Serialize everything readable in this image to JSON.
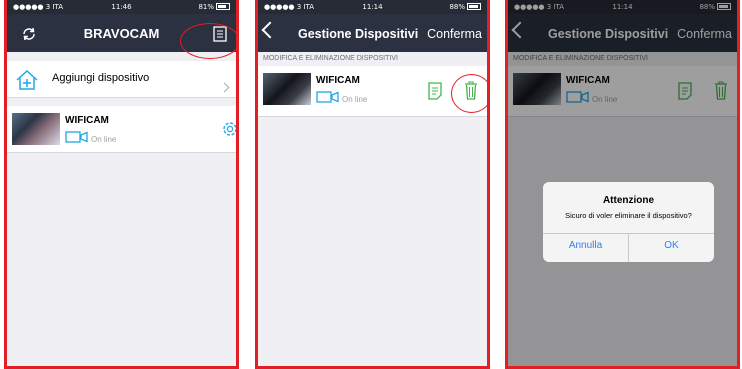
{
  "screens": [
    {
      "status": {
        "carrier": "●●●●● 3 ITA",
        "time": "11:46",
        "battery": "81%"
      },
      "nav": {
        "title": "BRAVOCAM"
      },
      "add_device": {
        "label": "Aggiungi dispositivo"
      },
      "device": {
        "name": "WIFICAM",
        "status": "On line"
      }
    },
    {
      "status": {
        "carrier": "●●●●● 3 ITA",
        "time": "11:14",
        "battery": "88%"
      },
      "nav": {
        "title": "Gestione Dispositivi",
        "confirm": "Conferma"
      },
      "section": "MODIFICA E ELIMINAZIONE DISPOSITIVI",
      "device": {
        "name": "WIFICAM",
        "status": "On line"
      }
    },
    {
      "status": {
        "carrier": "●●●●● 3 ITA",
        "time": "11:14",
        "battery": "88%"
      },
      "nav": {
        "title": "Gestione Dispositivi",
        "confirm": "Conferma"
      },
      "section": "MODIFICA E ELIMINAZIONE DISPOSITIVI",
      "device": {
        "name": "WIFICAM",
        "status": "On line"
      },
      "dialog": {
        "title": "Attenzione",
        "message": "Sicuro di voler eliminare il dispositivo?",
        "cancel": "Annulla",
        "ok": "OK"
      }
    }
  ],
  "colors": {
    "accent": "#e31e24",
    "nav": "#2b3140",
    "icon": "#20a7e6",
    "green": "#43b649",
    "link": "#2f7ff0"
  }
}
